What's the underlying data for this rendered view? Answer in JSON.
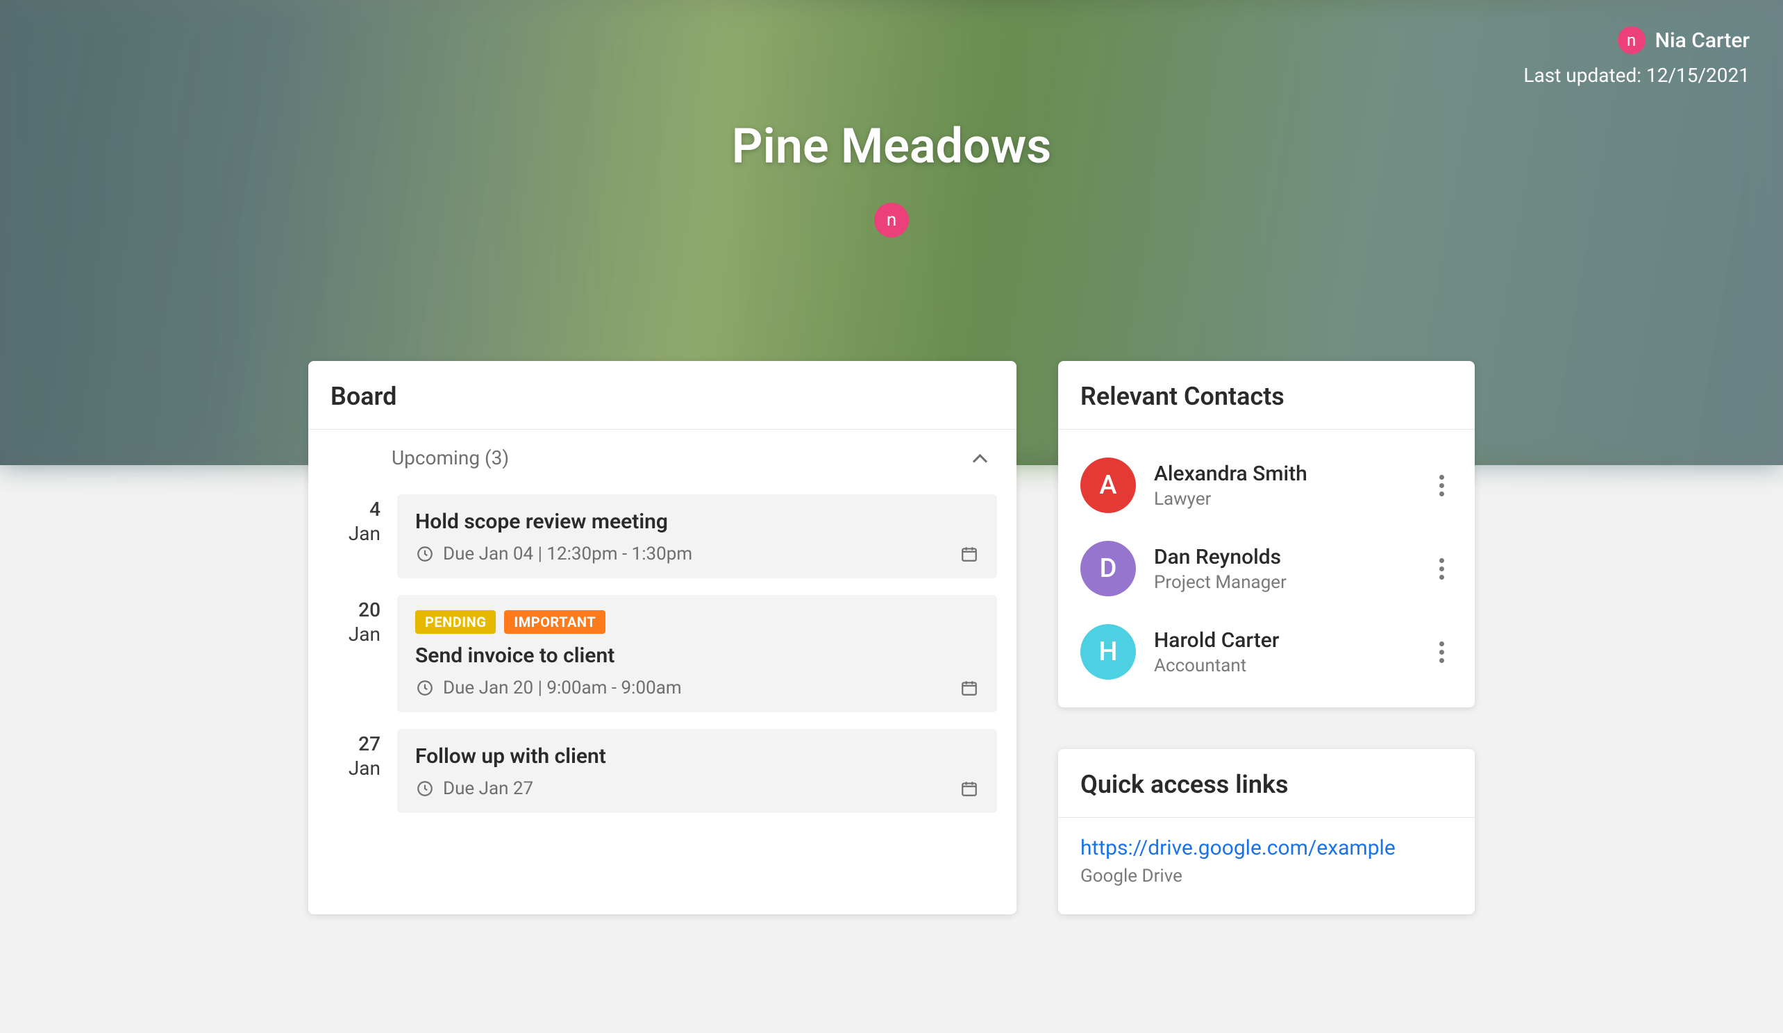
{
  "header": {
    "user_name": "Nia Carter",
    "user_initial": "n",
    "last_updated_label": "Last updated: 12/15/2021",
    "title": "Pine Meadows",
    "title_avatar_initial": "n"
  },
  "board": {
    "title": "Board",
    "section_label": "Upcoming (3)",
    "tasks": [
      {
        "day": "4",
        "month": "Jan",
        "tags": [],
        "title": "Hold scope review meeting",
        "due": "Due Jan 04 | 12:30pm - 1:30pm"
      },
      {
        "day": "20",
        "month": "Jan",
        "tags": [
          "PENDING",
          "IMPORTANT"
        ],
        "title": "Send invoice to client",
        "due": "Due Jan 20 | 9:00am - 9:00am"
      },
      {
        "day": "27",
        "month": "Jan",
        "tags": [],
        "title": "Follow up with client",
        "due": "Due Jan 27"
      }
    ]
  },
  "contacts": {
    "title": "Relevant Contacts",
    "items": [
      {
        "initial": "A",
        "name": "Alexandra Smith",
        "role": "Lawyer",
        "color": "av-red"
      },
      {
        "initial": "D",
        "name": "Dan Reynolds",
        "role": "Project Manager",
        "color": "av-purple"
      },
      {
        "initial": "H",
        "name": "Harold Carter",
        "role": "Accountant",
        "color": "av-teal"
      }
    ]
  },
  "links": {
    "title": "Quick access links",
    "items": [
      {
        "url": "https://drive.google.com/example",
        "label": "Google Drive"
      }
    ]
  }
}
